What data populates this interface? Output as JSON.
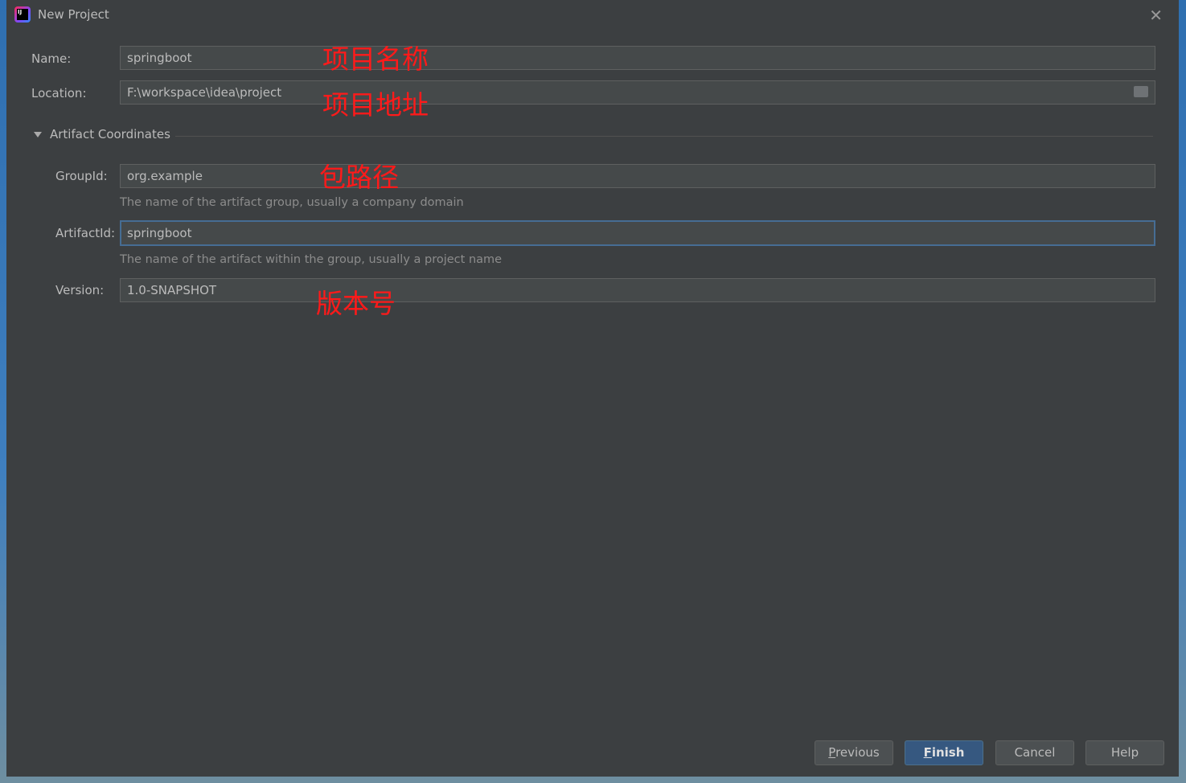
{
  "window": {
    "title": "New Project"
  },
  "form": {
    "name": {
      "label": "Name:",
      "value": "springboot"
    },
    "location": {
      "label": "Location:",
      "value": "F:\\workspace\\idea\\project"
    },
    "section": "Artifact Coordinates",
    "group_id": {
      "label": "GroupId:",
      "value": "org.example",
      "hint": "The name of the artifact group, usually a company domain"
    },
    "artifact_id": {
      "label": "ArtifactId:",
      "value": "springboot",
      "hint": "The name of the artifact within the group, usually a project name"
    },
    "version": {
      "label": "Version:",
      "value": "1.0-SNAPSHOT"
    }
  },
  "annotations": {
    "name": "项目名称",
    "location": "项目地址",
    "group": "包路径",
    "version": "版本号"
  },
  "buttons": {
    "previous_first": "P",
    "previous_rest": "revious",
    "finish_first": "F",
    "finish_rest": "inish",
    "cancel": "Cancel",
    "help": "Help"
  },
  "colors": {
    "annotation": "#ff1a1a",
    "primary_button": "#365880",
    "background": "#3c3f41"
  }
}
